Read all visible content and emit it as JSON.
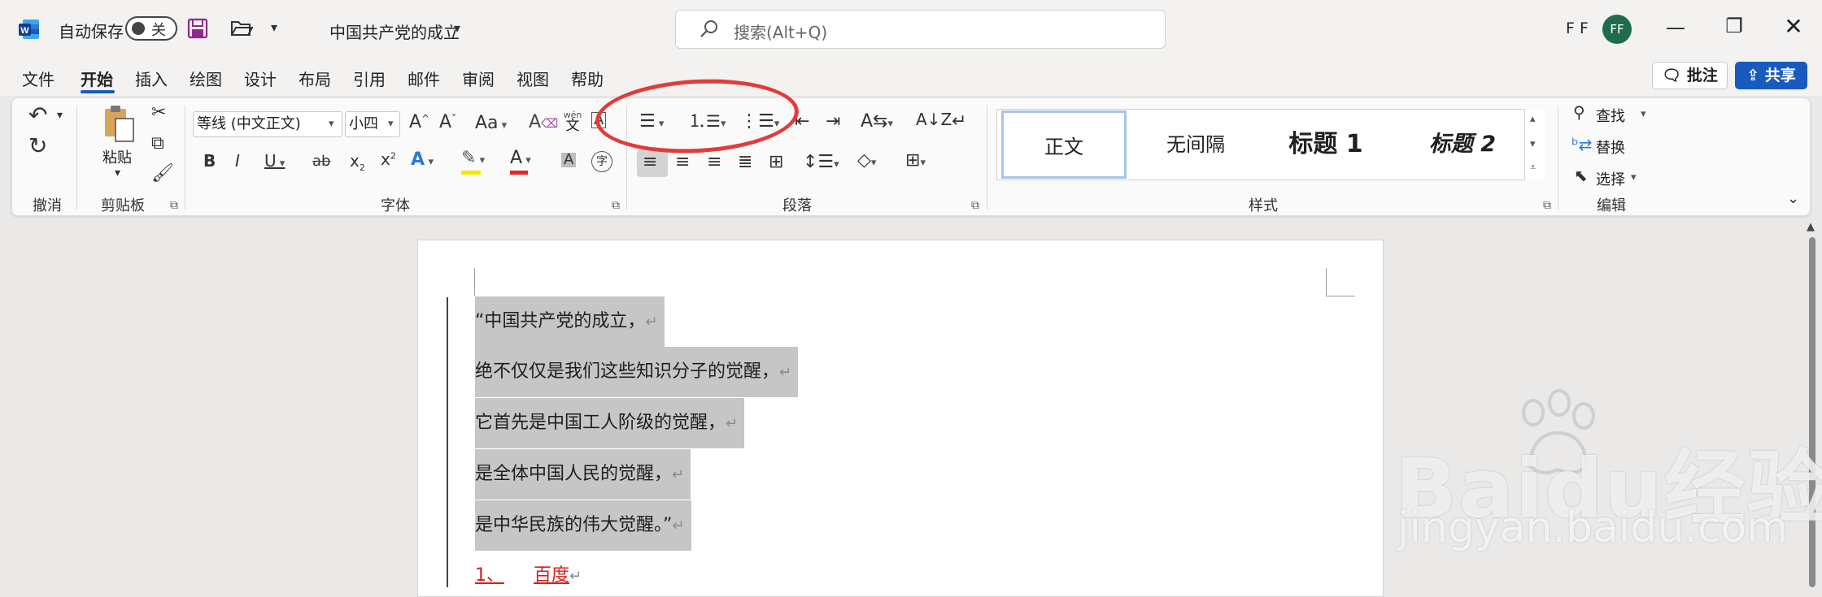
{
  "titlebar": {
    "app_icon": "word-icon",
    "autosave_label": "自动保存",
    "autosave_state": "关",
    "doc_title": "中国共产党的成立",
    "search_placeholder": "搜索(Alt+Q)",
    "user_initials_text": "F F",
    "avatar_initials": "FF",
    "avatar_color": "#1e6b4e"
  },
  "menu": {
    "items": [
      "文件",
      "开始",
      "插入",
      "绘图",
      "设计",
      "布局",
      "引用",
      "邮件",
      "审阅",
      "视图",
      "帮助"
    ],
    "active": "开始",
    "comment_label": "批注",
    "share_label": "共享"
  },
  "ribbon": {
    "groups": {
      "undo": "撤消",
      "clipboard": "剪贴板",
      "font": "字体",
      "paragraph": "段落",
      "styles": "样式",
      "editing": "编辑"
    },
    "paste_label": "粘贴",
    "font_name": "等线 (中文正文)",
    "font_size": "小四",
    "font_size_grow": "A^",
    "font_size_shrink": "A˅",
    "change_case": "Aa",
    "phonetic": "wén 文",
    "char_border": "A",
    "bold": "B",
    "italic": "I",
    "underline": "U",
    "strike": "ab",
    "subscript": "x₂",
    "superscript": "x²",
    "styles": [
      "正文",
      "无间隔",
      "标题 1",
      "标题 2"
    ],
    "find_label": "查找",
    "replace_label": "替换",
    "select_label": "选择"
  },
  "document": {
    "lines": [
      "“中国共产党的成立，",
      "绝不仅仅是我们这些知识分子的觉醒，",
      "它首先是中国工人阶级的觉醒，",
      "是全体中国人民的觉醒，",
      "是中华民族的伟大觉醒。”"
    ],
    "last_line_prefix": "1、",
    "last_line_text": "百度",
    "para_mark": "↵"
  },
  "watermark": {
    "text": "Baidu经验",
    "url": "jingyan.baidu.com"
  },
  "colors": {
    "accent": "#185abd",
    "highlight_ellipse": "#e23b3b",
    "selection": "#c6c6c6"
  }
}
